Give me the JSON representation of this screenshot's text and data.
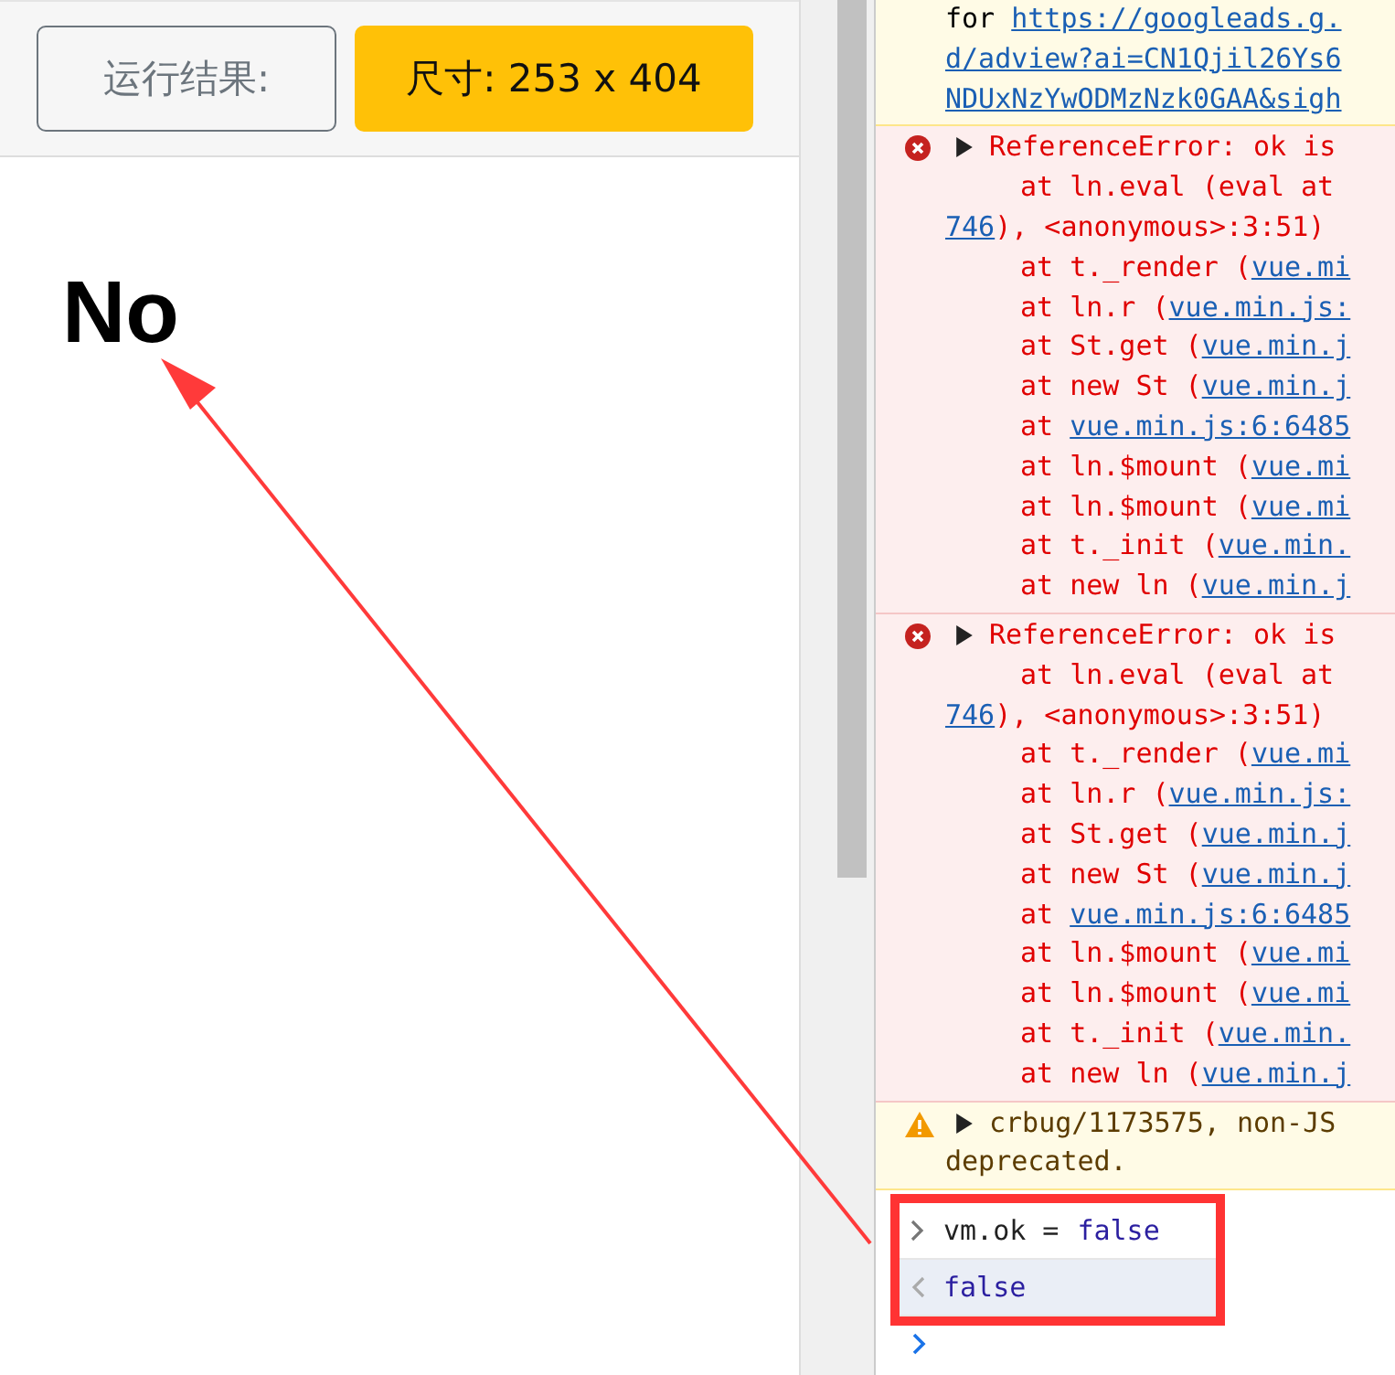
{
  "result_bar": {
    "label": "运行结果:",
    "size_badge": "尺寸: 253 x 404"
  },
  "output": {
    "text": "No"
  },
  "console": {
    "messages": [
      {
        "kind": "info",
        "lines": [
          {
            "kind": "cont",
            "segments": [
              {
                "text": "for ",
                "link": false
              },
              {
                "text": "https://googleads.g.",
                "link": true
              }
            ]
          },
          {
            "kind": "cont",
            "segments": [
              {
                "text": "d/adview?ai=CN1Qjil26Ys6",
                "link": true
              }
            ]
          },
          {
            "kind": "cont",
            "segments": [
              {
                "text": "NDUxNzYwODMzNzk0GAA&sigh",
                "link": true
              }
            ]
          }
        ]
      },
      {
        "kind": "error",
        "lines": [
          {
            "kind": "head",
            "segments": [
              {
                "text": "ReferenceError: ok is",
                "link": false
              }
            ]
          },
          {
            "kind": "frame",
            "segments": [
              {
                "text": "at ln.eval (eval at",
                "link": false
              }
            ]
          },
          {
            "kind": "cont",
            "segments": [
              {
                "text": "746",
                "link": true
              },
              {
                "text": "), <anonymous>:3:51)",
                "link": false
              }
            ]
          },
          {
            "kind": "frame",
            "segments": [
              {
                "text": "at t._render (",
                "link": false
              },
              {
                "text": "vue.mi",
                "link": true
              }
            ]
          },
          {
            "kind": "frame",
            "segments": [
              {
                "text": "at ln.r (",
                "link": false
              },
              {
                "text": "vue.min.js:",
                "link": true
              }
            ]
          },
          {
            "kind": "frame",
            "segments": [
              {
                "text": "at St.get (",
                "link": false
              },
              {
                "text": "vue.min.j",
                "link": true
              }
            ]
          },
          {
            "kind": "frame",
            "segments": [
              {
                "text": "at new St (",
                "link": false
              },
              {
                "text": "vue.min.j",
                "link": true
              }
            ]
          },
          {
            "kind": "frame",
            "segments": [
              {
                "text": "at ",
                "link": false
              },
              {
                "text": "vue.min.js:6:6485",
                "link": true
              }
            ]
          },
          {
            "kind": "frame",
            "segments": [
              {
                "text": "at ln.$mount (",
                "link": false
              },
              {
                "text": "vue.mi",
                "link": true
              }
            ]
          },
          {
            "kind": "frame",
            "segments": [
              {
                "text": "at ln.$mount (",
                "link": false
              },
              {
                "text": "vue.mi",
                "link": true
              }
            ]
          },
          {
            "kind": "frame",
            "segments": [
              {
                "text": "at t._init (",
                "link": false
              },
              {
                "text": "vue.min.",
                "link": true
              }
            ]
          },
          {
            "kind": "frame",
            "segments": [
              {
                "text": "at new ln (",
                "link": false
              },
              {
                "text": "vue.min.j",
                "link": true
              }
            ]
          }
        ]
      },
      {
        "kind": "error",
        "lines": [
          {
            "kind": "head",
            "segments": [
              {
                "text": "ReferenceError: ok is",
                "link": false
              }
            ]
          },
          {
            "kind": "frame",
            "segments": [
              {
                "text": "at ln.eval (eval at",
                "link": false
              }
            ]
          },
          {
            "kind": "cont",
            "segments": [
              {
                "text": "746",
                "link": true
              },
              {
                "text": "), <anonymous>:3:51)",
                "link": false
              }
            ]
          },
          {
            "kind": "frame",
            "segments": [
              {
                "text": "at t._render (",
                "link": false
              },
              {
                "text": "vue.mi",
                "link": true
              }
            ]
          },
          {
            "kind": "frame",
            "segments": [
              {
                "text": "at ln.r (",
                "link": false
              },
              {
                "text": "vue.min.js:",
                "link": true
              }
            ]
          },
          {
            "kind": "frame",
            "segments": [
              {
                "text": "at St.get (",
                "link": false
              },
              {
                "text": "vue.min.j",
                "link": true
              }
            ]
          },
          {
            "kind": "frame",
            "segments": [
              {
                "text": "at new St (",
                "link": false
              },
              {
                "text": "vue.min.j",
                "link": true
              }
            ]
          },
          {
            "kind": "frame",
            "segments": [
              {
                "text": "at ",
                "link": false
              },
              {
                "text": "vue.min.js:6:6485",
                "link": true
              }
            ]
          },
          {
            "kind": "frame",
            "segments": [
              {
                "text": "at ln.$mount (",
                "link": false
              },
              {
                "text": "vue.mi",
                "link": true
              }
            ]
          },
          {
            "kind": "frame",
            "segments": [
              {
                "text": "at ln.$mount (",
                "link": false
              },
              {
                "text": "vue.mi",
                "link": true
              }
            ]
          },
          {
            "kind": "frame",
            "segments": [
              {
                "text": "at t._init (",
                "link": false
              },
              {
                "text": "vue.min.",
                "link": true
              }
            ]
          },
          {
            "kind": "frame",
            "segments": [
              {
                "text": "at new ln (",
                "link": false
              },
              {
                "text": "vue.min.j",
                "link": true
              }
            ]
          }
        ]
      },
      {
        "kind": "warning",
        "lines": [
          {
            "kind": "head",
            "segments": [
              {
                "text": "crbug/1173575, non-JS",
                "link": false
              }
            ]
          },
          {
            "kind": "cont",
            "segments": [
              {
                "text": "deprecated.",
                "link": false
              }
            ]
          }
        ]
      }
    ],
    "input": {
      "code": "vm.ok =",
      "value": "false"
    },
    "result": "false"
  }
}
